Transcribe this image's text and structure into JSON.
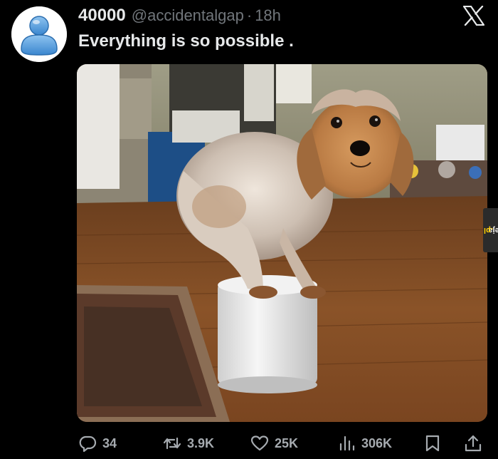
{
  "tweet": {
    "display_name": "40000",
    "handle": "@accidentalgap",
    "separator": "·",
    "time": "18h",
    "text": "Everything is so possible .",
    "avatar_icon": "default-user-avatar-icon",
    "platform_icon": "x-logo-icon"
  },
  "media": {
    "kind": "photo"
  },
  "watermark": {
    "brand": "jeja",
    "domain": ".pl"
  },
  "actions": {
    "replies": "34",
    "retweets": "3.9K",
    "likes": "25K",
    "views": "306K"
  },
  "colors": {
    "background": "#000000",
    "text_primary": "#e7e9ea",
    "text_secondary": "#71767b",
    "watermark_accent": "#ffcc00"
  }
}
